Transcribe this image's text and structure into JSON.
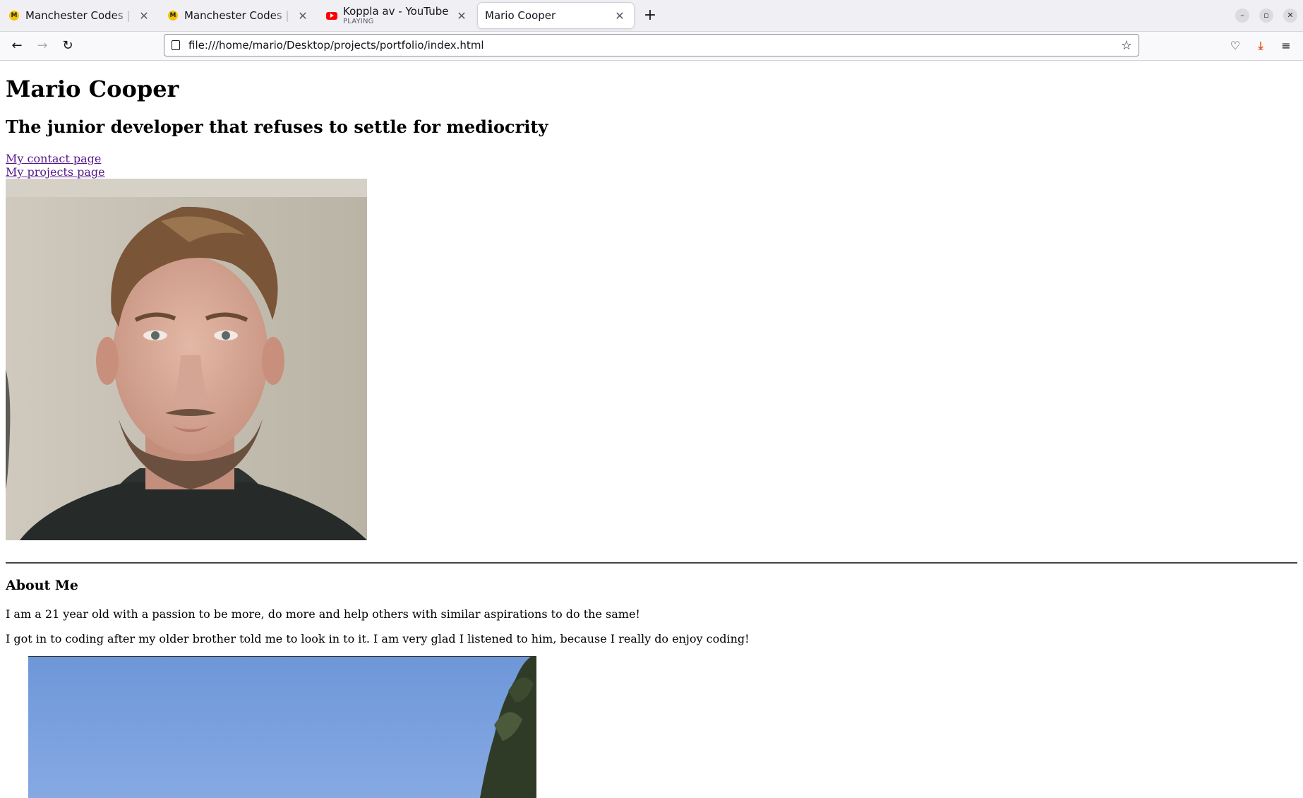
{
  "browser": {
    "tabs": [
      {
        "title": "Manchester Codes | Learn",
        "favicon": "manchester-codes-icon",
        "active": false
      },
      {
        "title": "Manchester Codes | Learn",
        "favicon": "manchester-codes-icon",
        "active": false
      },
      {
        "title": "Koppla av - YouTube",
        "subtitle": "PLAYING",
        "favicon": "youtube-icon",
        "active": false
      },
      {
        "title": "Mario Cooper",
        "favicon": "none",
        "active": true
      }
    ],
    "url": "file:///home/mario/Desktop/projects/portfolio/index.html",
    "accent": "#e25920"
  },
  "page": {
    "name": "Mario Cooper",
    "tagline": "The junior developer that refuses to settle for mediocrity",
    "links": {
      "contact": "My contact page",
      "projects": "My projects page"
    },
    "about": {
      "heading": "About Me",
      "paragraphs": [
        "I am a 21 year old with a passion to be more, do more and help others with similar aspirations to do the same!",
        "I got in to coding after my older brother told me to look in to it. I am very glad I listened to him, because I really do enjoy coding!"
      ]
    }
  }
}
